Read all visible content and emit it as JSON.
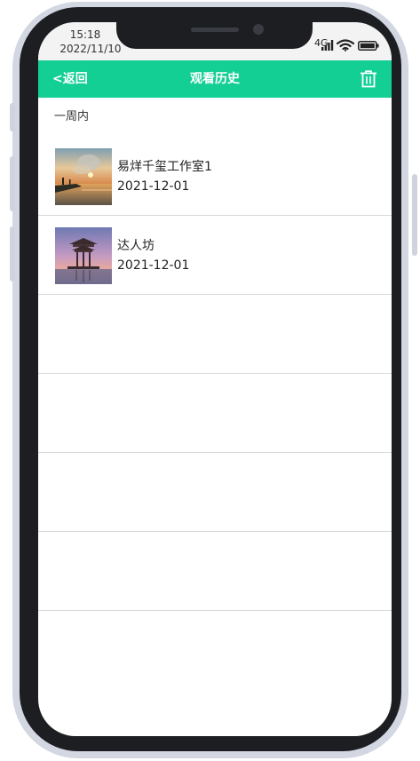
{
  "status_bar": {
    "time": "15:18",
    "date": "2022/11/10",
    "network": "4G"
  },
  "nav": {
    "back_label": "<返回",
    "title": "观看历史",
    "delete_icon": "trash-icon",
    "background_color": "#13cf94"
  },
  "section": {
    "label": "一周内"
  },
  "history": [
    {
      "title": "易烊千玺工作室1",
      "date": "2021-12-01",
      "thumbnail": "lake-sunset-photo"
    },
    {
      "title": "达人坊",
      "date": "2021-12-01",
      "thumbnail": "pavilion-dusk-photo"
    },
    {
      "title": "",
      "date": ""
    },
    {
      "title": "",
      "date": ""
    },
    {
      "title": "",
      "date": ""
    },
    {
      "title": "",
      "date": ""
    }
  ]
}
